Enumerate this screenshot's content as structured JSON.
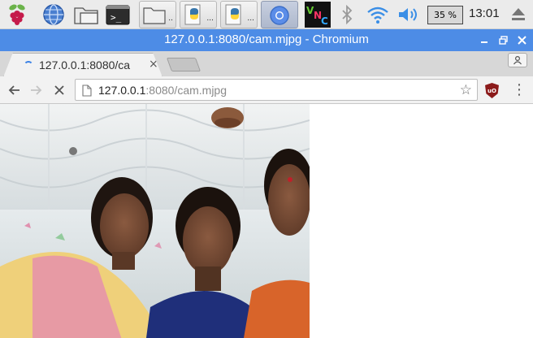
{
  "taskbar": {
    "cpu": "35 %",
    "clock": "13:01",
    "apps": [
      {
        "name": "file-manager"
      },
      {
        "name": "python-editor-1"
      },
      {
        "name": "python-editor-2"
      },
      {
        "name": "chromium"
      },
      {
        "name": "vnc-viewer"
      }
    ]
  },
  "window": {
    "title": "127.0.0.1:8080/cam.mjpg - Chromium"
  },
  "tab": {
    "title": "127.0.0.1:8080/ca",
    "close": "×"
  },
  "toolbar": {
    "url_host": "127.0.0.1",
    "url_path": ":8080/cam.mjpg",
    "ublock": "uO"
  },
  "colors": {
    "titlebar": "#4d8ce6",
    "taskbar": "#ebebeb",
    "accent": "#3b82e6"
  }
}
